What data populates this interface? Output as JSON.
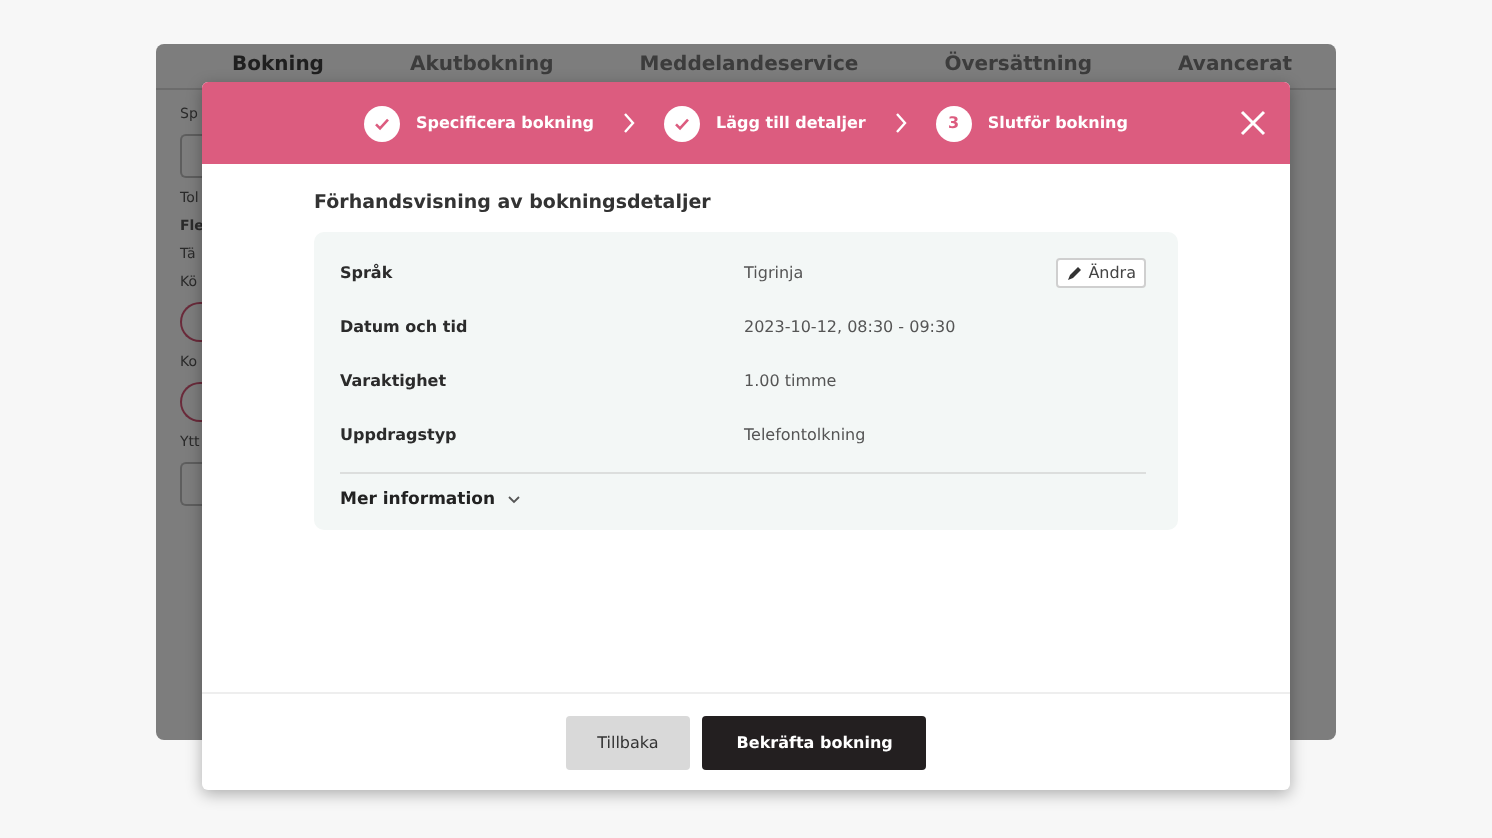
{
  "background": {
    "tabs": [
      {
        "label": "Bokning",
        "selected": true
      },
      {
        "label": "Akutbokning",
        "selected": false
      },
      {
        "label": "Meddelandeservice",
        "selected": false
      },
      {
        "label": "Översättning",
        "selected": false
      },
      {
        "label": "Avancerat",
        "selected": false
      }
    ],
    "labels": [
      {
        "text": "Sp",
        "kind": "label"
      },
      {
        "kind": "field"
      },
      {
        "text": "Tol",
        "kind": "label"
      },
      {
        "text": "Fle",
        "kind": "heading"
      },
      {
        "text": "Tä",
        "kind": "label"
      },
      {
        "text": "Kö",
        "kind": "label"
      },
      {
        "kind": "radio"
      },
      {
        "text": "Ko",
        "kind": "label"
      },
      {
        "kind": "radio"
      },
      {
        "text": "Ytt",
        "kind": "label"
      },
      {
        "kind": "field"
      }
    ]
  },
  "modal": {
    "steps": [
      {
        "label": "Specificera bokning",
        "completed": true
      },
      {
        "label": "Lägg till detaljer",
        "completed": true
      },
      {
        "number": "3",
        "label": "Slutför bokning",
        "completed": false
      }
    ],
    "title": "Förhandsvisning av bokningsdetaljer",
    "details": [
      {
        "label": "Språk",
        "value": "Tigrinja"
      },
      {
        "label": "Datum och tid",
        "value": "2023-10-12, 08:30 - 09:30"
      },
      {
        "label": "Varaktighet",
        "value": "1.00 timme"
      },
      {
        "label": "Uppdragstyp",
        "value": "Telefontolkning"
      }
    ],
    "edit_button": "Ändra",
    "more_info": {
      "label": "Mer information",
      "expanded": false
    },
    "buttons": [
      {
        "label": "Tillbaka",
        "kind": "secondary"
      },
      {
        "label": "Bekräfta bokning",
        "kind": "primary"
      }
    ]
  }
}
